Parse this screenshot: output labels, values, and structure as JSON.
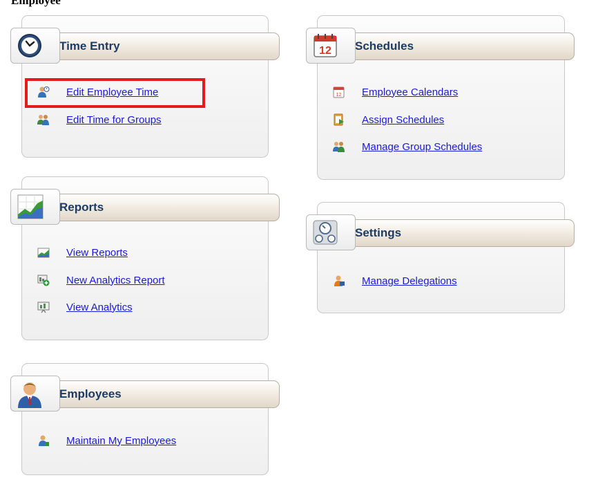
{
  "page": {
    "cutoff_title": "Employee"
  },
  "cards": {
    "time_entry": {
      "title": "Time Entry",
      "links": [
        "Edit Employee Time",
        "Edit Time for Groups"
      ]
    },
    "schedules": {
      "title": "Schedules",
      "calendar_day": "12",
      "links": [
        "Employee Calendars",
        "Assign Schedules",
        "Manage Group Schedules"
      ]
    },
    "reports": {
      "title": "Reports",
      "links": [
        "View Reports",
        "New Analytics Report",
        "View Analytics"
      ]
    },
    "settings": {
      "title": "Settings",
      "links": [
        "Manage Delegations"
      ]
    },
    "employees": {
      "title": "Employees",
      "links": [
        "Maintain My Employees"
      ]
    }
  },
  "icons": {
    "time_entry": "clock-icon",
    "schedules": "calendar-icon",
    "reports": "chart-icon",
    "settings": "settings-dials-icon",
    "employees": "employee-person-icon"
  },
  "colors": {
    "title_text": "#1c3c63",
    "link": "#1a1ad8",
    "highlight": "#e31b1b",
    "header_band": "#e1d7c9"
  }
}
